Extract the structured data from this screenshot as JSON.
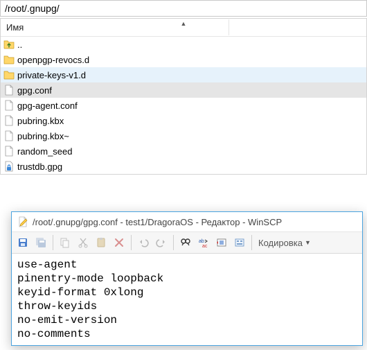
{
  "pathbar": {
    "text": "/root/.gnupg/"
  },
  "columns": {
    "name": "Имя"
  },
  "files": [
    {
      "icon": "folder-up",
      "label": ".."
    },
    {
      "icon": "folder-yellow",
      "label": "openpgp-revocs.d"
    },
    {
      "icon": "folder-yellow",
      "label": "private-keys-v1.d",
      "sel": "light"
    },
    {
      "icon": "file-plain",
      "label": "gpg.conf",
      "sel": "gray"
    },
    {
      "icon": "file-plain",
      "label": "gpg-agent.conf"
    },
    {
      "icon": "file-plain",
      "label": "pubring.kbx"
    },
    {
      "icon": "file-plain",
      "label": "pubring.kbx~"
    },
    {
      "icon": "file-plain",
      "label": "random_seed"
    },
    {
      "icon": "file-lock",
      "label": "trustdb.gpg"
    }
  ],
  "editor": {
    "title": "/root/.gnupg/gpg.conf - test1/DragoraOS - Редактор - WinSCP",
    "encoding_label": "Кодировка",
    "content": "use-agent\npinentry-mode loopback\nkeyid-format 0xlong\nthrow-keyids\nno-emit-version\nno-comments"
  },
  "toolbar_icons": [
    "save-icon",
    "save-all-icon",
    "copy-icon",
    "cut-icon",
    "paste-icon",
    "delete-icon",
    "undo-icon",
    "redo-icon",
    "find-icon",
    "replace-icon",
    "goto-icon",
    "settings-icon"
  ]
}
